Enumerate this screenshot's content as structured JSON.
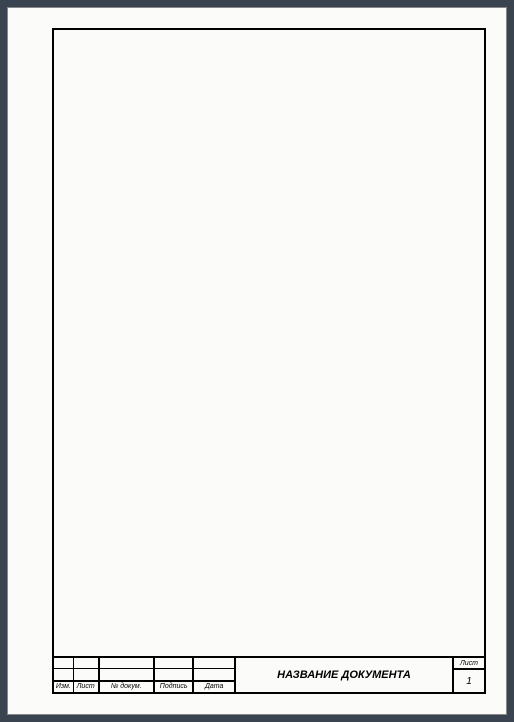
{
  "titleBlock": {
    "documentTitle": "НАЗВАНИЕ ДОКУМЕНТА",
    "sheetLabel": "Лист",
    "sheetNumber": "1",
    "columns": {
      "izm": "Изм.",
      "list": "Лист",
      "doc": "№ докум.",
      "sign": "Подпись",
      "date": "Дата"
    }
  }
}
